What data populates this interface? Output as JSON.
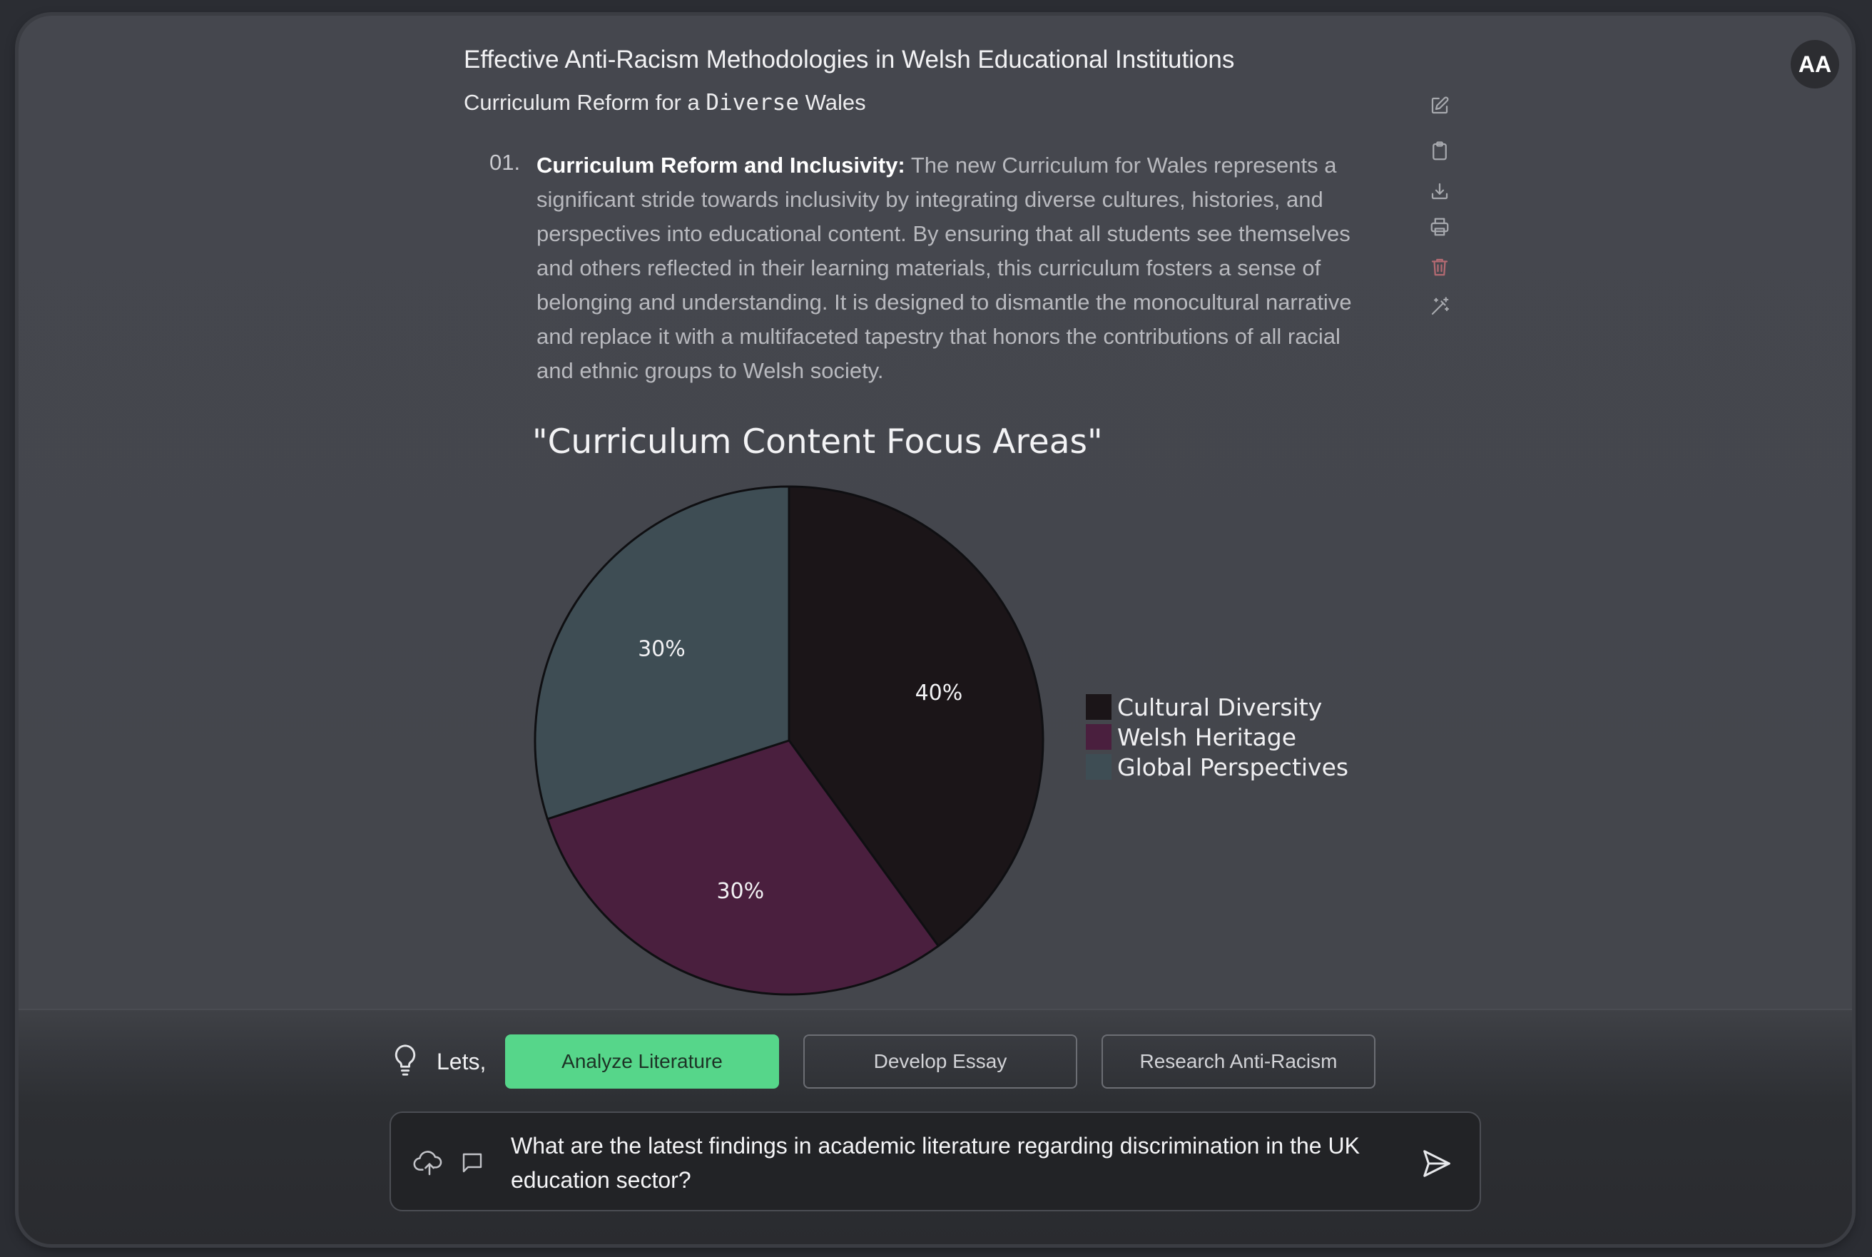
{
  "user": {
    "initials": "AA"
  },
  "document": {
    "title": "Effective Anti-Racism Methodologies in Welsh Educational Institutions",
    "subtitle_before": "Curriculum Reform for a ",
    "subtitle_mono": "Diverse",
    "subtitle_after": " Wales",
    "items": [
      {
        "number": "01.",
        "heading": "Curriculum Reform and Inclusivity:",
        "body": " The new Curriculum for Wales represents a significant stride towards inclusivity by integrating diverse cultures, histories, and perspectives into educational content. By ensuring that all students see themselves and others reflected in their learning materials, this curriculum fosters a sense of belonging and understanding. It is designed to dismantle the monocultural narrative and replace it with a multifaceted tapestry that honors the contributions of all racial and ethnic groups to Welsh society."
      }
    ]
  },
  "toolbar": {
    "icons": [
      "edit-icon",
      "clipboard-icon",
      "download-icon",
      "print-icon",
      "trash-icon",
      "magic-wand-icon"
    ]
  },
  "chart_data": {
    "type": "pie",
    "title": "\"Curriculum Content Focus Areas\"",
    "labels": [
      "Cultural Diversity",
      "Welsh Heritage",
      "Global Perspectives"
    ],
    "values": [
      40,
      30,
      30
    ],
    "value_labels": [
      "40%",
      "30%",
      "30%"
    ],
    "colors": [
      "#1b1518",
      "#4a1f3e",
      "#3e4d54"
    ],
    "legend_position": "right"
  },
  "suggestions": {
    "prefix": "Lets,",
    "items": [
      {
        "label": "Analyze Literature",
        "style": "primary"
      },
      {
        "label": "Develop Essay",
        "style": "ghost"
      },
      {
        "label": "Research Anti-Racism",
        "style": "ghost"
      }
    ]
  },
  "composer": {
    "text": "What are the latest findings in academic literature regarding discrimination in the UK education sector?"
  }
}
